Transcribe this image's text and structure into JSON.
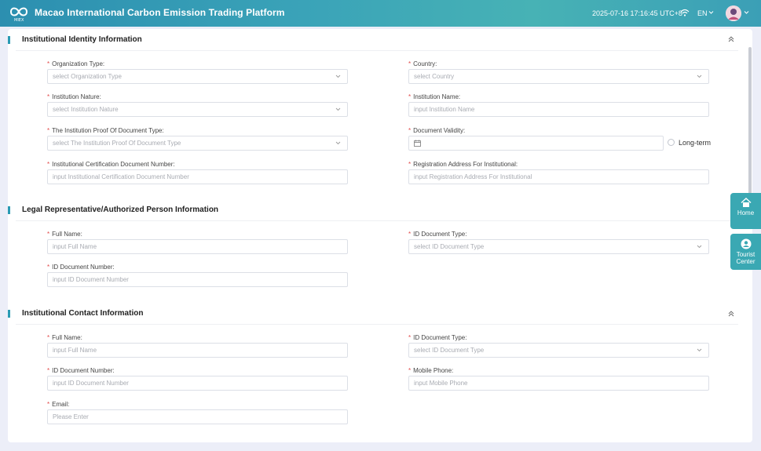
{
  "header": {
    "title": "Macao International Carbon Emission Trading Platform",
    "datetime": "2025-07-16 17:16:45 UTC+8",
    "language": "EN",
    "logo_text": "MIEX"
  },
  "sections": {
    "institutional_identity": {
      "title": "Institutional Identity Information",
      "fields": {
        "org_type": {
          "label": "Organization Type:",
          "placeholder": "select Organization Type"
        },
        "country": {
          "label": "Country:",
          "placeholder": "select Country"
        },
        "inst_nature": {
          "label": "Institution Nature:",
          "placeholder": "select Institution Nature"
        },
        "inst_name": {
          "label": "Institution Name:",
          "placeholder": "input Institution Name"
        },
        "proof_type": {
          "label": "The Institution Proof Of Document Type:",
          "placeholder": "select The Institution Proof Of Document Type"
        },
        "doc_validity": {
          "label": "Document Validity:",
          "placeholder": ""
        },
        "long_term": "Long-term",
        "cert_number": {
          "label": "Institutional Certification Document Number:",
          "placeholder": "input Institutional Certification Document Number"
        },
        "reg_address": {
          "label": "Registration Address For Institutional:",
          "placeholder": "input Registration Address For Institutional"
        }
      }
    },
    "legal_rep": {
      "title": "Legal Representative/Authorized Person Information",
      "fields": {
        "full_name": {
          "label": "Full Name:",
          "placeholder": "input Full Name"
        },
        "id_type": {
          "label": "ID Document Type:",
          "placeholder": "select ID Document Type"
        },
        "id_number": {
          "label": "ID Document Number:",
          "placeholder": "input ID Document Number"
        }
      }
    },
    "contact": {
      "title": "Institutional Contact Information",
      "fields": {
        "full_name": {
          "label": "Full Name:",
          "placeholder": "input Full Name"
        },
        "id_type": {
          "label": "ID Document Type:",
          "placeholder": "select ID Document Type"
        },
        "id_number": {
          "label": "ID Document Number:",
          "placeholder": "input ID Document Number"
        },
        "mobile": {
          "label": "Mobile Phone:",
          "placeholder": "input Mobile Phone"
        },
        "email": {
          "label": "Email:",
          "placeholder": "Please Enter"
        }
      }
    }
  },
  "float_buttons": {
    "home": "Home",
    "tourist_center_line1": "Tourist",
    "tourist_center_line2": "Center"
  },
  "required_mark": "*",
  "colors": {
    "accent": "#2a9bb4",
    "required": "#e24a4a",
    "header": "#3aa3b8"
  }
}
